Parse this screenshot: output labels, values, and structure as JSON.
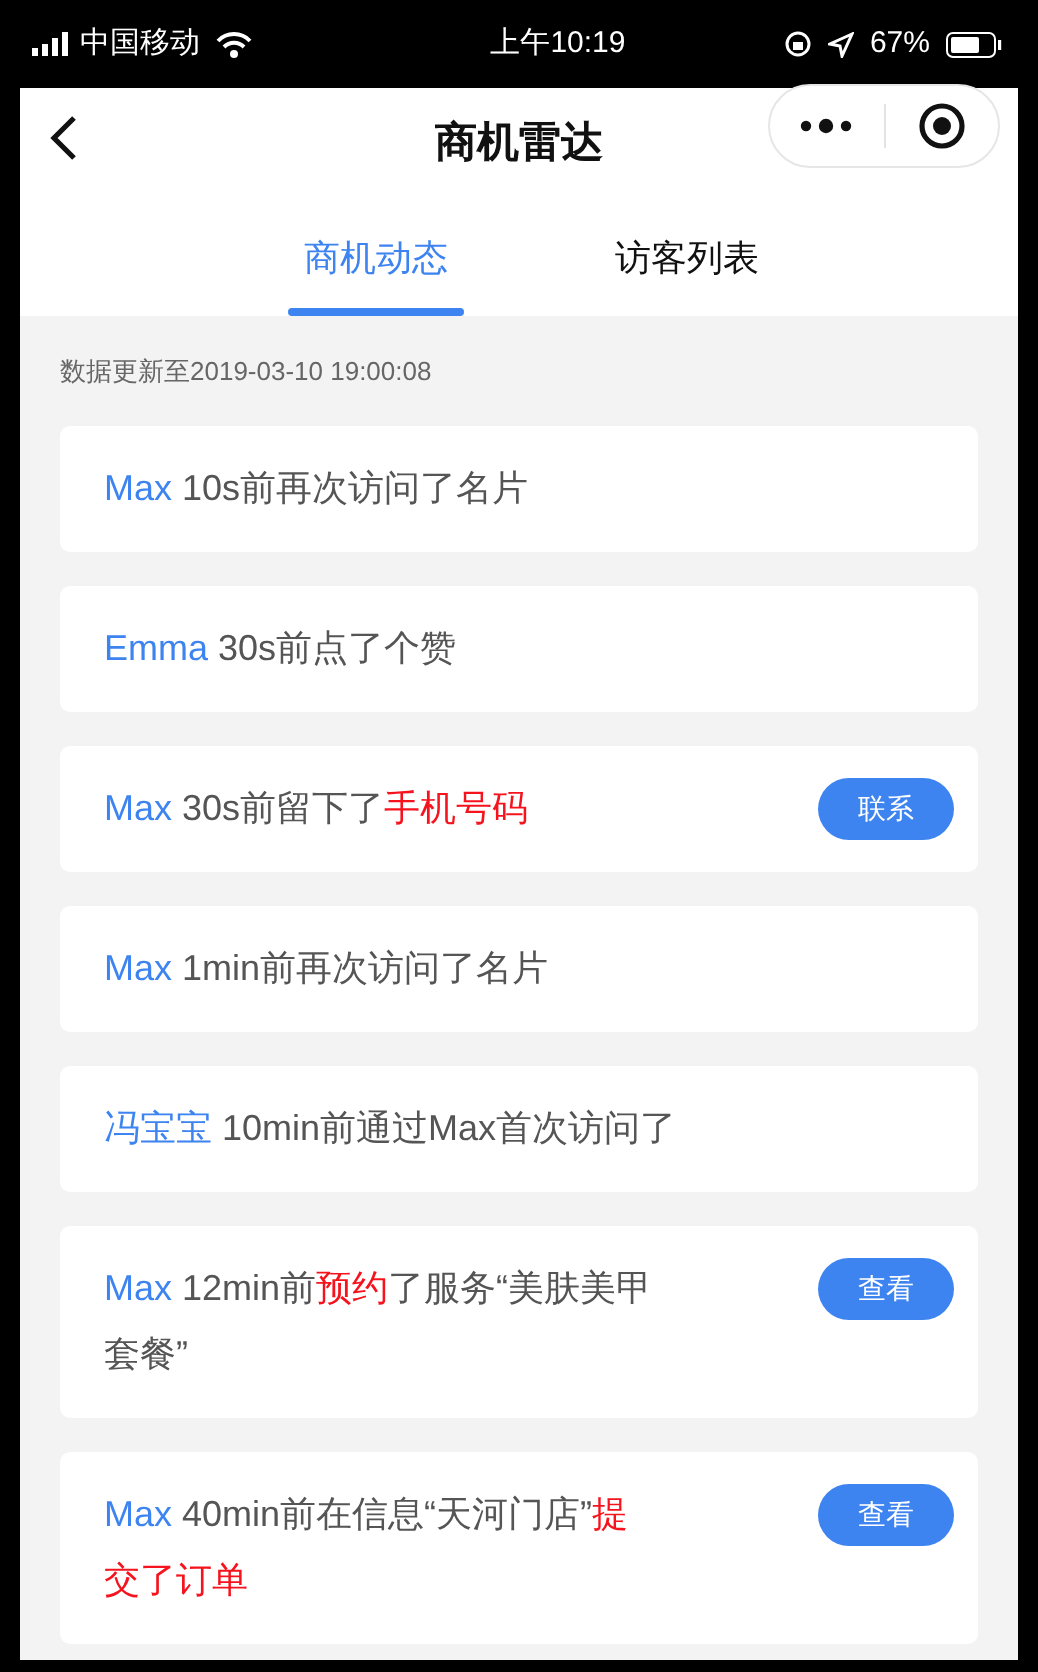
{
  "status_bar": {
    "carrier": "中国移动",
    "time": "上午10:19",
    "battery": "67%"
  },
  "nav": {
    "title": "商机雷达"
  },
  "tabs": [
    {
      "label": "商机动态",
      "selected": true
    },
    {
      "label": "访客列表",
      "selected": false
    }
  ],
  "update_note": "数据更新至2019-03-10 19:00:08",
  "feed": [
    {
      "segments": [
        {
          "kind": "name",
          "text": "Max"
        },
        {
          "kind": "plain",
          "text": " 10s前再次访问了名片"
        }
      ]
    },
    {
      "segments": [
        {
          "kind": "name",
          "text": "Emma"
        },
        {
          "kind": "plain",
          "text": " 30s前点了个赞"
        }
      ]
    },
    {
      "segments": [
        {
          "kind": "name",
          "text": "Max"
        },
        {
          "kind": "plain",
          "text": " 30s前留下了"
        },
        {
          "kind": "highlight",
          "text": "手机号码"
        }
      ],
      "button": "联系"
    },
    {
      "segments": [
        {
          "kind": "name",
          "text": "Max"
        },
        {
          "kind": "plain",
          "text": " 1min前再次访问了名片"
        }
      ]
    },
    {
      "segments": [
        {
          "kind": "name",
          "text": "冯宝宝"
        },
        {
          "kind": "plain",
          "text": " 10min前通过Max首次访问了"
        }
      ]
    },
    {
      "segments": [
        {
          "kind": "name",
          "text": "Max"
        },
        {
          "kind": "plain",
          "text": " 12min前"
        },
        {
          "kind": "highlight",
          "text": "预约"
        },
        {
          "kind": "plain",
          "text": "了服务“美肤美甲套餐”"
        }
      ],
      "button": "查看"
    },
    {
      "segments": [
        {
          "kind": "name",
          "text": "Max"
        },
        {
          "kind": "plain",
          "text": " 40min前在信息“天河门店”"
        },
        {
          "kind": "highlight",
          "text": "提交了订单"
        }
      ],
      "button": "查看"
    }
  ]
}
